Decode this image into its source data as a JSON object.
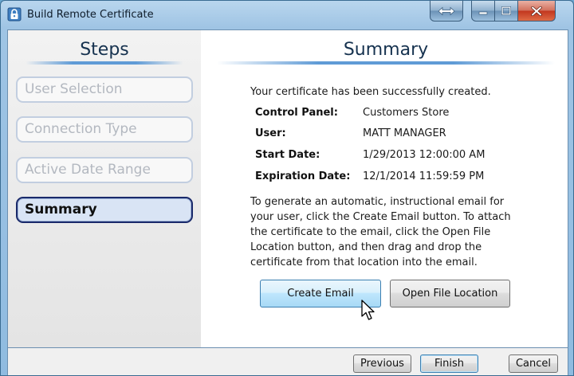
{
  "window": {
    "title": "Build Remote Certificate"
  },
  "steps": {
    "heading": "Steps",
    "items": [
      {
        "label": "User Selection"
      },
      {
        "label": "Connection Type"
      },
      {
        "label": "Active Date Range"
      },
      {
        "label": "Summary"
      }
    ]
  },
  "summary": {
    "heading": "Summary",
    "success_message": "Your certificate has been successfully created.",
    "details": [
      {
        "label": "Control Panel:",
        "value": "Customers Store"
      },
      {
        "label": "User:",
        "value": "MATT MANAGER"
      },
      {
        "label": "Start Date:",
        "value": "1/29/2013 12:00:00 AM"
      },
      {
        "label": "Expiration Date:",
        "value": "12/1/2014 11:59:59 PM"
      }
    ],
    "instructions": "To generate an automatic, instructional email for your user, click the Create Email button. To attach the certificate to the email, click the Open File Location button, and then drag and drop the certificate from that location into the email.",
    "create_email_label": "Create Email",
    "open_location_label": "Open File Location"
  },
  "footer": {
    "previous_label": "Previous",
    "finish_label": "Finish",
    "cancel_label": "Cancel"
  },
  "icons": {
    "title": "certificate-lock-icon",
    "resize": "resize-arrows-icon",
    "minimize": "minimize-icon",
    "maximize": "maximize-icon",
    "close": "close-icon",
    "cursor": "mouse-pointer-icon"
  },
  "colors": {
    "heading": "#16324f",
    "active_step_border": "#1a2a6b",
    "heading_rule": "#5f9bd6",
    "close_button": "#c2361e"
  }
}
